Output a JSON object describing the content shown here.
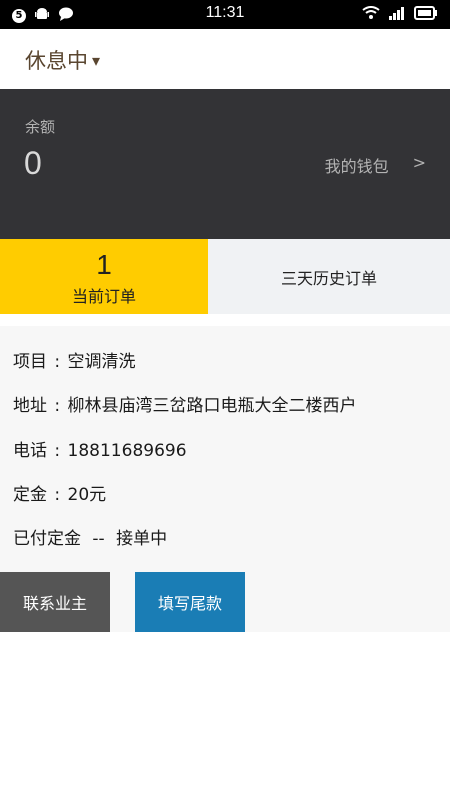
{
  "status_bar": {
    "time": "11:31",
    "badge": "5"
  },
  "header": {
    "status": "休息中",
    "caret": "▾"
  },
  "wallet": {
    "balance_label": "余额",
    "balance_value": "0",
    "link_label": "我的钱包",
    "link_arrow": ">"
  },
  "tabs": {
    "current": {
      "count": "1",
      "label": "当前订单"
    },
    "history": {
      "label": "三天历史订单"
    }
  },
  "order": {
    "project_label": "项目",
    "project_value": "空调清洗",
    "address_label": "地址",
    "address_value": "柳林县庙湾三岔路口电瓶大全二楼西户",
    "phone_label": "电话",
    "phone_value": "18811689696",
    "deposit_label": "定金",
    "deposit_value": "20元",
    "paid_status": "已付定金",
    "dash": "--",
    "order_status": "接单中",
    "separator": ":"
  },
  "actions": {
    "contact": "联系业主",
    "fill_balance": "填写尾款"
  },
  "colors": {
    "accent": "#ffcc00",
    "dark_panel": "#333336",
    "primary_button": "#1a7db5",
    "secondary_button": "#555555"
  }
}
